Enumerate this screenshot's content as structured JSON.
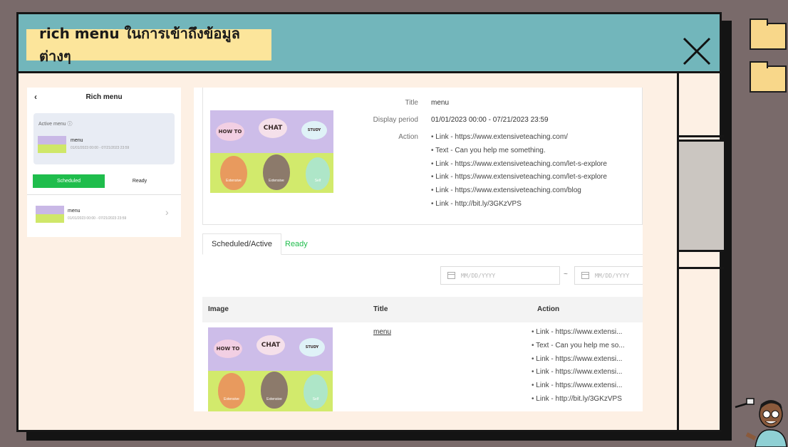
{
  "slide": {
    "title": "rich menu ในการเข้าถึงข้อมูลต่างๆ"
  },
  "mobile": {
    "back_icon": "chevron-left-icon",
    "header_title": "Rich menu",
    "active_label": "Active menu",
    "active_item": {
      "title": "menu",
      "period": "01/01/2023 00:00 - 07/21/2023 23:59"
    },
    "tabs": [
      "Scheduled",
      "Ready"
    ],
    "list_item": {
      "title": "menu",
      "period": "01/01/2023 00:00 - 07/21/2023 23:59"
    }
  },
  "detail": {
    "title_label": "Title",
    "title_value": "menu",
    "period_label": "Display period",
    "period_value": "01/01/2023 00:00 - 07/21/2023 23:59",
    "action_label": "Action",
    "actions": [
      "Link - https://www.extensiveteaching.com/",
      "Text - Can you help me something.",
      "Link - https://www.extensiveteaching.com/let-s-explore",
      "Link - https://www.extensiveteaching.com/let-s-explore",
      "Link - https://www.extensiveteaching.com/blog",
      "Link - http://bit.ly/3GKzVPS"
    ]
  },
  "tabs": {
    "scheduled_active": "Scheduled/Active",
    "ready": "Ready"
  },
  "date_filter": {
    "start_placeholder": "MM/DD/YYYY",
    "separator": "~",
    "end_placeholder": "MM/DD/YYYY"
  },
  "table": {
    "headers": [
      "Image",
      "Title",
      "Action"
    ],
    "row": {
      "title": "menu",
      "actions": [
        "Link - https://www.extensi...",
        "Text - Can you help me so...",
        "Link - https://www.extensi...",
        "Link - https://www.extensi...",
        "Link - https://www.extensi...",
        "Link - http://bit.ly/3GKzVPS"
      ]
    }
  },
  "thumbnail": {
    "top_labels": [
      "HOW TO",
      "CHAT",
      "STUDY"
    ],
    "bottom_labels": [
      "Extensive",
      "Extensive",
      "Self"
    ]
  },
  "colors": {
    "accent_green": "#1fbd4c",
    "title_bar": "#72b6bb",
    "title_tag": "#fce59b"
  }
}
